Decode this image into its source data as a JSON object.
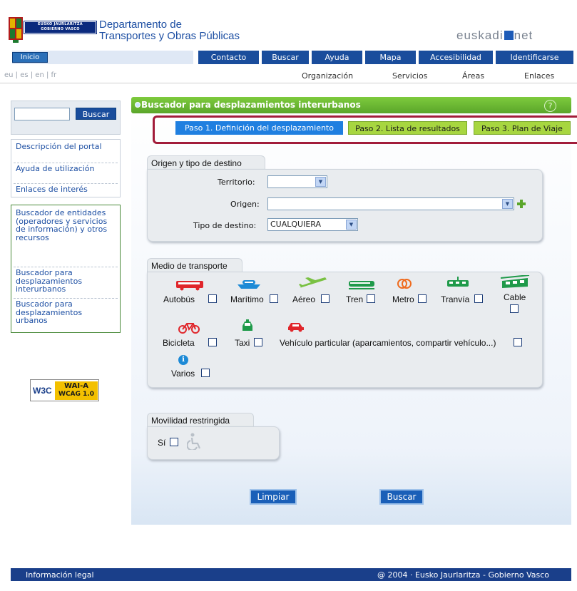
{
  "header": {
    "logo_text_line1": "EUSKO JAURLARITZA",
    "logo_text_line2": "GOBIERNO VASCO",
    "dept_title_line1": "Departamento de",
    "dept_title_line2": "Transportes y Obras Públicas",
    "portal_brand_left": "euskadi",
    "portal_brand_right": "net"
  },
  "topnav": {
    "inicio": "Inicio",
    "items": [
      "Contacto",
      "Buscar",
      "Ayuda",
      "Mapa",
      "Accesibilidad",
      "Identificarse"
    ]
  },
  "subnav": {
    "languages": "eu | es | en | fr",
    "items": [
      "Organización",
      "Servicios",
      "Áreas",
      "Enlaces"
    ]
  },
  "sidebar": {
    "search_placeholder": "",
    "search_button": "Buscar",
    "menu1": [
      "Descripción del portal",
      "Ayuda de utilización",
      "Enlaces de interés"
    ],
    "menu2": [
      "Buscador de entidades (operadores y servicios de información) y otros recursos",
      "Buscador para desplazamientos interurbanos",
      "Buscador para desplazamientos urbanos"
    ],
    "badge_w3c": "W3C",
    "badge_wai": "WAI-A",
    "badge_wcag": "WCAG 1.0"
  },
  "main": {
    "title": "Buscador para desplazamientos interurbanos",
    "help": "?",
    "steps": [
      "Paso 1. Definición del desplazamiento",
      "Paso 2. Lista de resultados",
      "Paso 3. Plan de Viaje"
    ],
    "origin_section": {
      "legend": "Origen y tipo de destino",
      "territorio_label": "Territorio:",
      "territorio_value": "",
      "origen_label": "Origen:",
      "origen_value": "",
      "tipo_label": "Tipo de destino:",
      "tipo_value": "CUALQUIERA"
    },
    "transport_section": {
      "legend": "Medio de transporte",
      "modes": [
        "Autobús",
        "Marítimo",
        "Aéreo",
        "Tren",
        "Metro",
        "Tranvía",
        "Cable",
        "Bicicleta",
        "Taxi",
        "Vehículo particular (aparcamientos, compartir vehículo...)",
        "Varios"
      ]
    },
    "mobility_section": {
      "legend": "Movilidad restringida",
      "yes_label": "Sí"
    },
    "buttons": {
      "clear": "Limpiar",
      "search": "Buscar"
    }
  },
  "footer": {
    "left": "Información legal",
    "right": "@ 2004 · Eusko Jaurlaritza - Gobierno Vasco"
  },
  "colors": {
    "nav_blue": "#1a4d9c",
    "header_green": "#6cb834",
    "step_active": "#1f7fe0",
    "step_inactive": "#a7d640",
    "frame_red": "#a21c3a"
  }
}
